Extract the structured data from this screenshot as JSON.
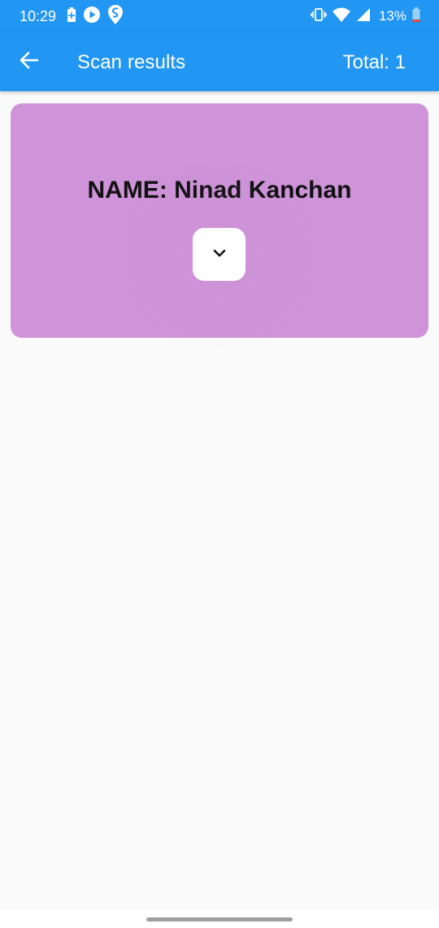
{
  "status_bar": {
    "time": "10:29",
    "battery_percent": "13%",
    "background": "#2196f3",
    "left_icons": [
      "battery-saver-icon",
      "play-icon",
      "swiggy-icon"
    ],
    "right_icons": [
      "vibrate-icon",
      "wifi-icon",
      "signal-icon",
      "battery-icon"
    ]
  },
  "app_bar": {
    "back_icon": "arrow-back-icon",
    "title": "Scan results",
    "total": "Total: 1",
    "background": "#2196f3"
  },
  "result_card": {
    "name": "NAME: Ninad Kanchan",
    "background": "#ce93d8",
    "expand_icon": "chevron-down-icon"
  }
}
